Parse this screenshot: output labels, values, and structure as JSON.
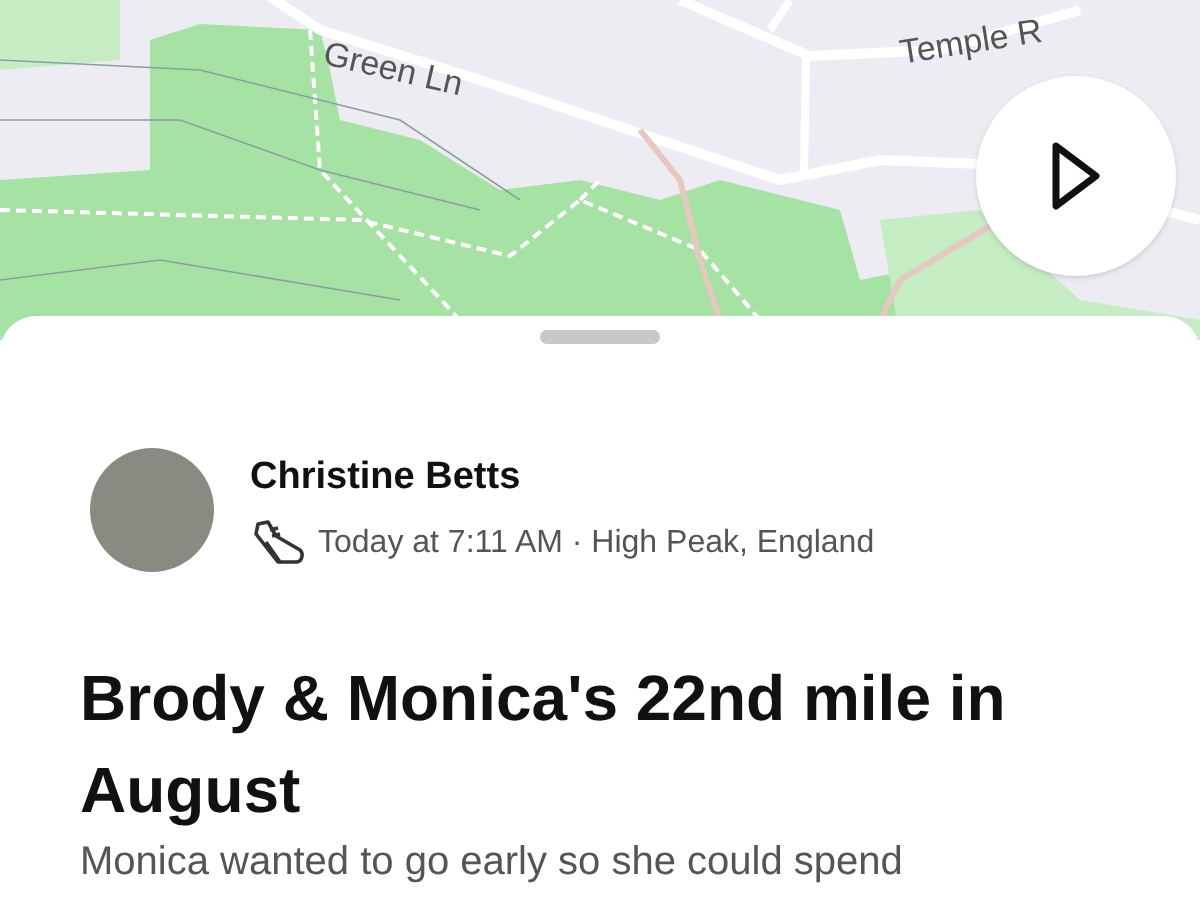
{
  "map": {
    "street_labels": [
      "Green Ln",
      "Temple R"
    ]
  },
  "athlete": {
    "name": "Christine Betts",
    "meta": "Today at 7:11 AM · High Peak, England"
  },
  "activity": {
    "title": "Brody & Monica's 22nd mile in August",
    "description": "Monica wanted to go early so she could spend"
  }
}
